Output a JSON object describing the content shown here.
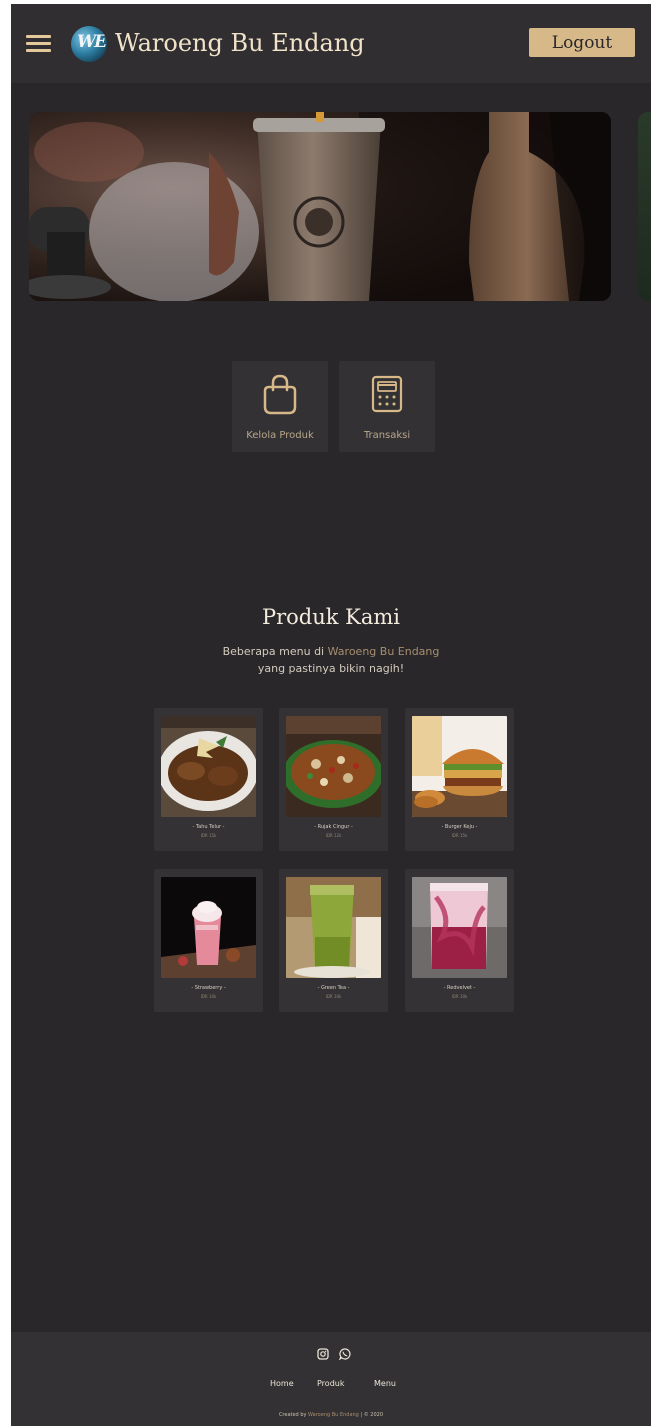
{
  "header": {
    "brand": "Waroeng Bu Endang",
    "logo_text": "WE",
    "logout_label": "Logout"
  },
  "colors": {
    "background": "#29272a",
    "header": "#302e31",
    "accent": "#d6b889",
    "tile": "#333134"
  },
  "actions": [
    {
      "label": "Kelola Produk",
      "icon": "shopping-bag-icon"
    },
    {
      "label": "Transaksi",
      "icon": "calculator-icon"
    }
  ],
  "products_section": {
    "title": "Produk Kami",
    "subtitle_before": "Beberapa menu di ",
    "subtitle_accent": "Waroeng Bu Endang",
    "subtitle_line2": "yang pastinya bikin nagih!"
  },
  "products": [
    {
      "name": "- Tahu Telur -",
      "price": "IDR 15k"
    },
    {
      "name": "- Rujak Cingur -",
      "price": "IDR 12k"
    },
    {
      "name": "- Burger Keju -",
      "price": "IDR 15k"
    },
    {
      "name": "- Strawberry -",
      "price": "IDR 10k"
    },
    {
      "name": "- Green Tea -",
      "price": "IDR 10k"
    },
    {
      "name": "- Redvelvet -",
      "price": "IDR 10k"
    }
  ],
  "footer": {
    "social": [
      "instagram-icon",
      "whatsapp-icon"
    ],
    "links": [
      "Home",
      "Produk",
      "Menu"
    ],
    "credit_before": "Created by ",
    "credit_accent": "Waroeng Bu Endang",
    "credit_after": " | © 2020"
  }
}
